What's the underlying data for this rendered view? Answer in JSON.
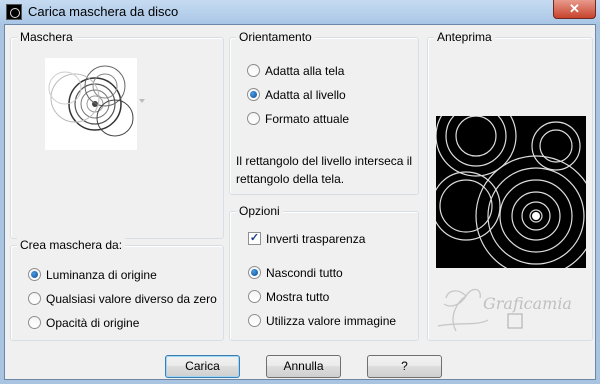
{
  "window": {
    "title": "Carica maschera da disco",
    "close_label": "✕"
  },
  "maschera": {
    "title": "Maschera"
  },
  "crea": {
    "title": "Crea maschera da:",
    "options": [
      {
        "label": "Luminanza di origine",
        "checked": true
      },
      {
        "label": "Qualsiasi valore diverso da zero",
        "checked": false
      },
      {
        "label": "Opacità di origine",
        "checked": false
      }
    ]
  },
  "orientamento": {
    "title": "Orientamento",
    "options": [
      {
        "label": "Adatta alla tela",
        "checked": false
      },
      {
        "label": "Adatta al livello",
        "checked": true
      },
      {
        "label": "Formato attuale",
        "checked": false
      }
    ],
    "info": "Il rettangolo del livello interseca il rettangolo della tela."
  },
  "opzioni": {
    "title": "Opzioni",
    "invert_label": "Inverti trasparenza",
    "invert_checked": true,
    "options": [
      {
        "label": "Nascondi tutto",
        "checked": true
      },
      {
        "label": "Mostra tutto",
        "checked": false
      },
      {
        "label": "Utilizza valore immagine",
        "checked": false
      }
    ]
  },
  "anteprima": {
    "title": "Anteprima"
  },
  "buttons": {
    "ok": "Carica",
    "cancel": "Annulla",
    "help": "?"
  },
  "watermark": "Graficamia"
}
